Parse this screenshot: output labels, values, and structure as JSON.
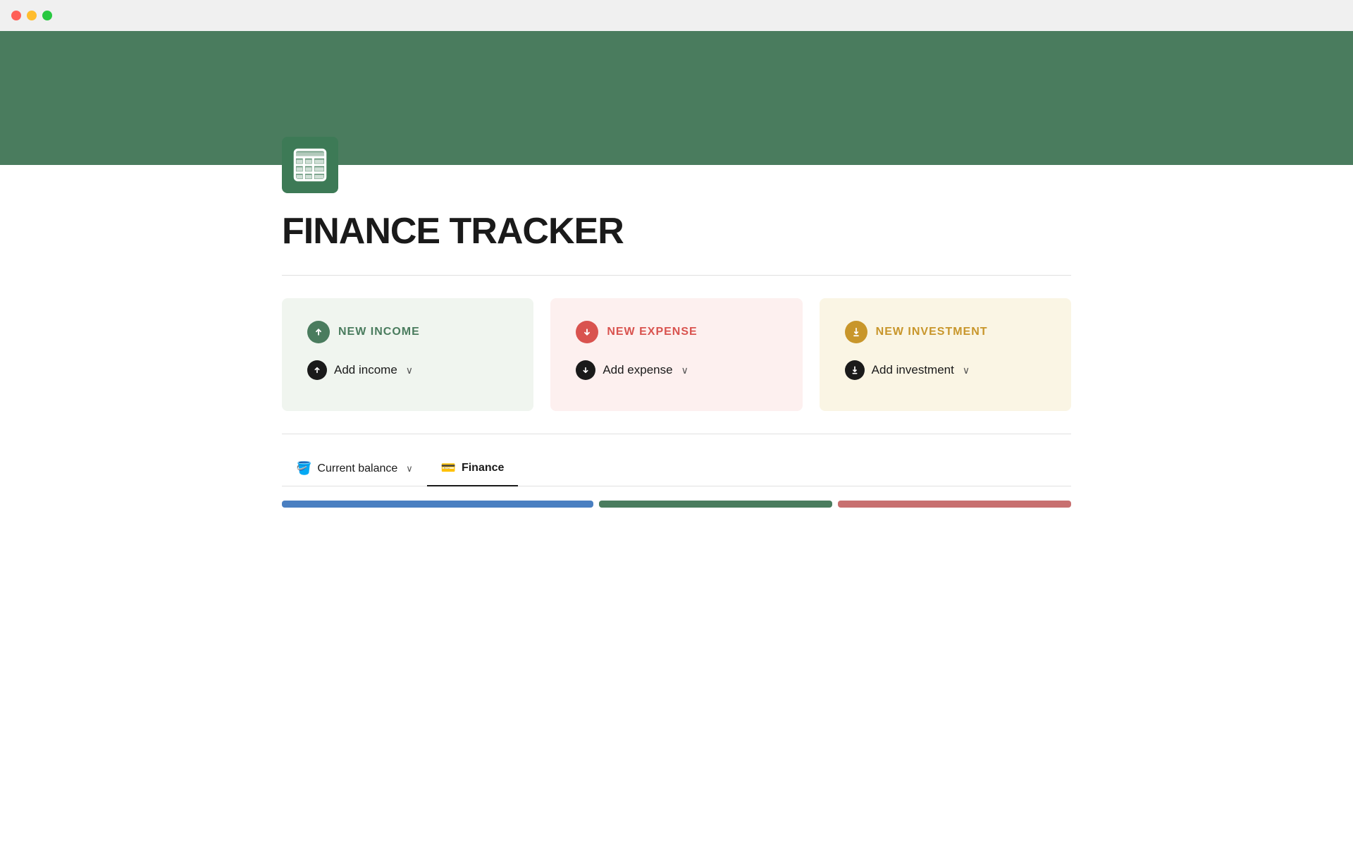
{
  "titlebar": {
    "lights": [
      "red",
      "yellow",
      "green"
    ]
  },
  "hero": {
    "background_color": "#4a7c5e"
  },
  "page": {
    "icon_label": "spreadsheet-icon",
    "title": "FINANCE TRACKER"
  },
  "cards": [
    {
      "id": "income",
      "title": "NEW INCOME",
      "title_color": "#4a7c5e",
      "bg_color": "#f0f5ef",
      "icon_circle_color": "#4a7c5e",
      "icon_symbol": "↑",
      "action_label": "Add income",
      "action_icon": "↑",
      "chevron": "⌄"
    },
    {
      "id": "expense",
      "title": "NEW EXPENSE",
      "title_color": "#d9534f",
      "bg_color": "#fdf0ef",
      "icon_circle_color": "#d9534f",
      "icon_symbol": "↓",
      "action_label": "Add expense",
      "action_icon": "↓",
      "chevron": "⌄"
    },
    {
      "id": "investment",
      "title": "NEW INVESTMENT",
      "title_color": "#c8962b",
      "bg_color": "#faf5e4",
      "icon_circle_color": "#c8962b",
      "icon_symbol": "↓",
      "action_label": "Add investment",
      "action_icon": "⬇",
      "chevron": "⌄"
    }
  ],
  "tabs": {
    "balance_label": "Current balance",
    "balance_icon": "🪣",
    "finance_label": "Finance",
    "finance_icon": "💳"
  }
}
